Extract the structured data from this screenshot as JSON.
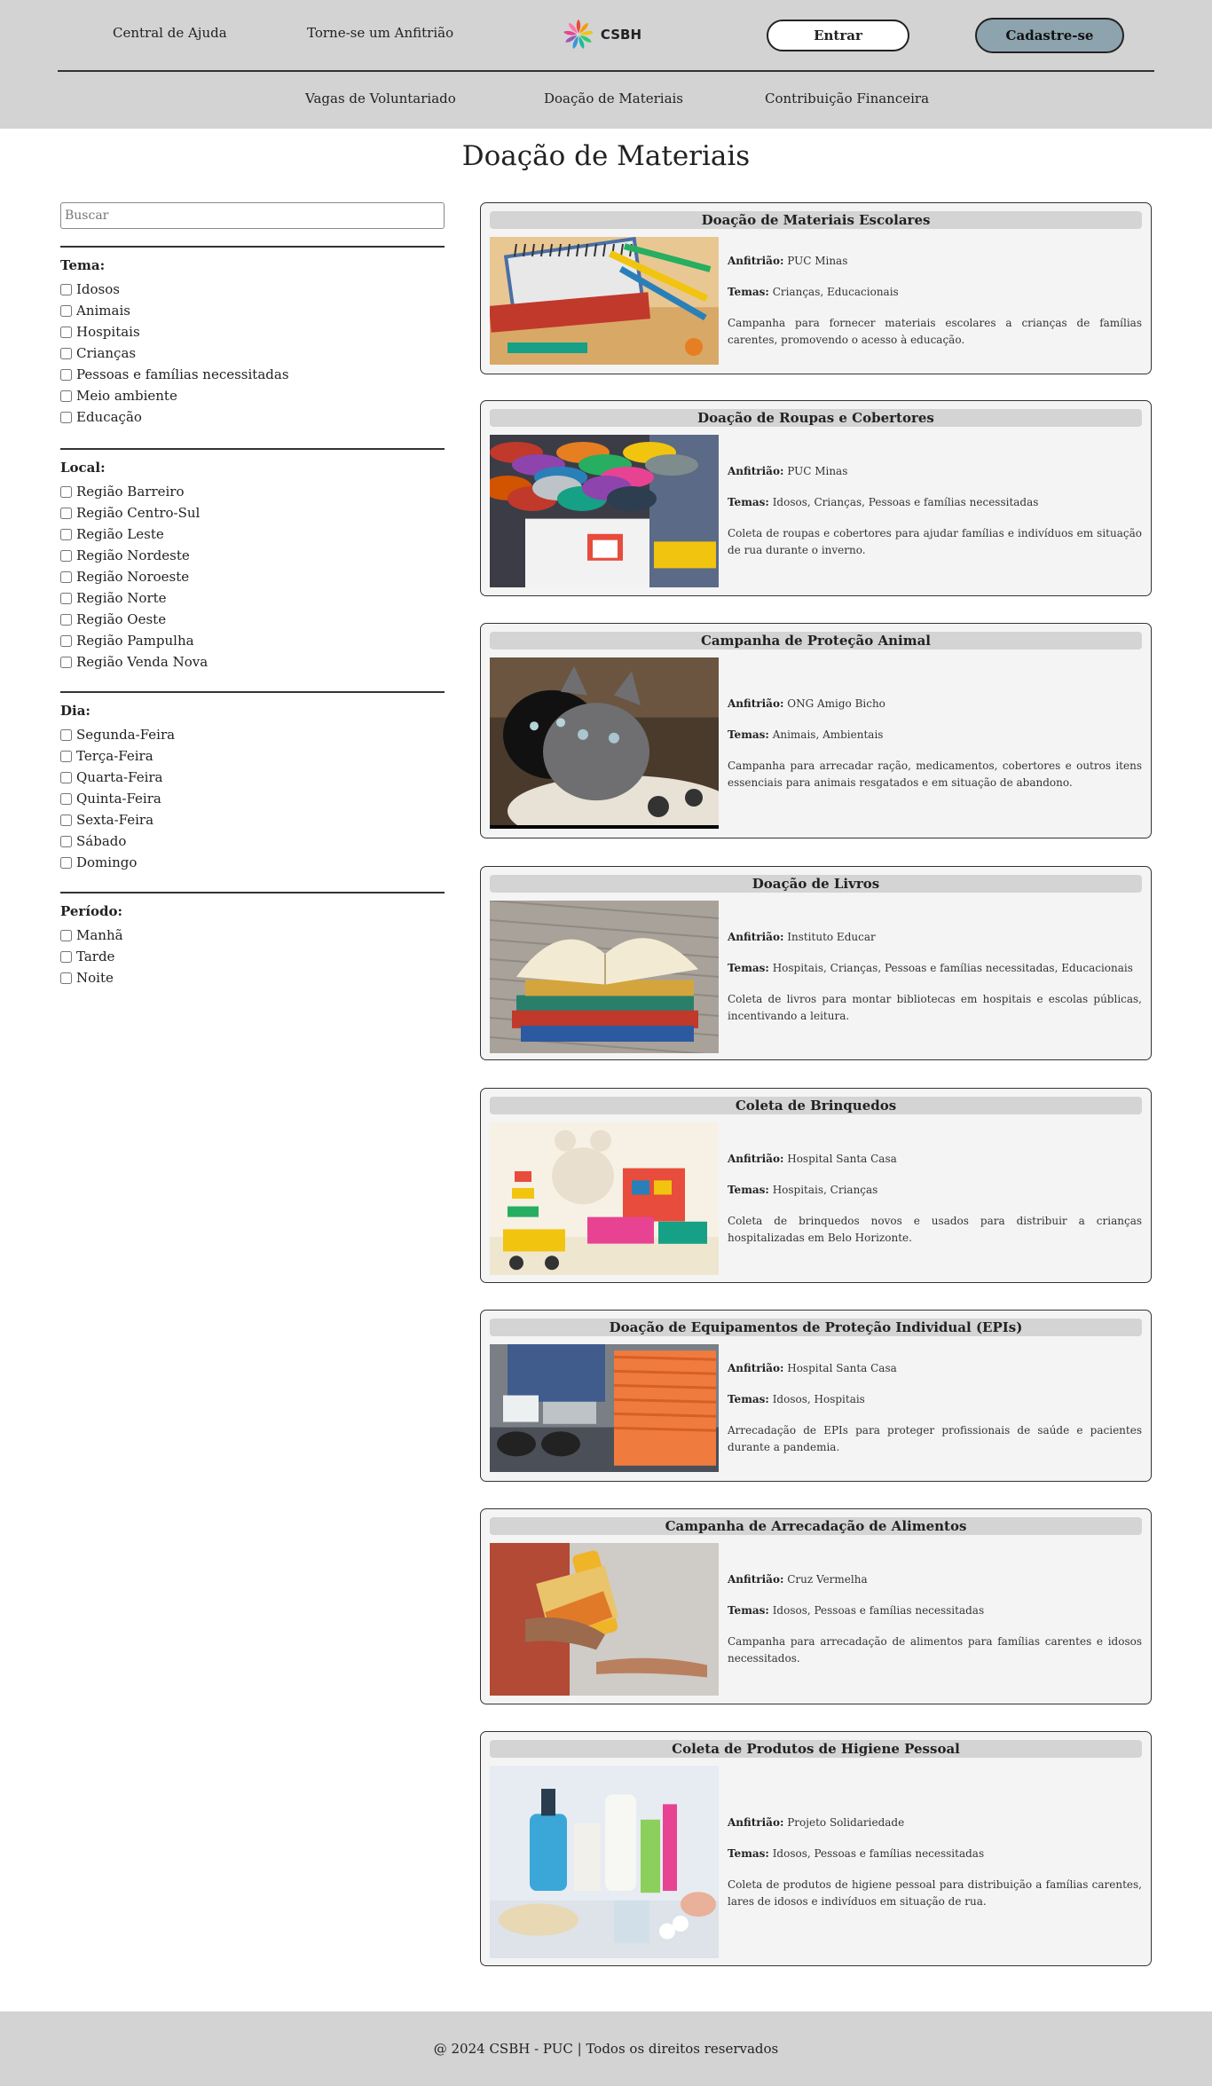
{
  "header": {
    "help_label": "Central de Ajuda",
    "host_label": "Torne-se um Anfitrião",
    "logo_text": "CSBH",
    "login_label": "Entrar",
    "signup_label": "Cadastre-se",
    "nav": [
      "Vagas de Voluntariado",
      "Doação de Materiais",
      "Contribuição Financeira"
    ]
  },
  "page_title": "Doação de Materiais",
  "search": {
    "placeholder": "Buscar"
  },
  "filters": [
    {
      "title": "Tema:",
      "options": [
        "Idosos",
        "Animais",
        "Hospitais",
        "Crianças",
        "Pessoas e famílias necessitadas",
        "Meio ambiente",
        "Educação"
      ]
    },
    {
      "title": "Local:",
      "options": [
        "Região Barreiro",
        "Região Centro-Sul",
        "Região Leste",
        "Região Nordeste",
        "Região Noroeste",
        "Região Norte",
        "Região Oeste",
        "Região Pampulha",
        "Região Venda Nova"
      ]
    },
    {
      "title": "Dia:",
      "options": [
        "Segunda-Feira",
        "Terça-Feira",
        "Quarta-Feira",
        "Quinta-Feira",
        "Sexta-Feira",
        "Sábado",
        "Domingo"
      ]
    },
    {
      "title": "Período:",
      "options": [
        "Manhã",
        "Tarde",
        "Noite"
      ]
    }
  ],
  "card_labels": {
    "host": "Anfitrião:",
    "themes": "Temas:"
  },
  "cards": [
    {
      "title": "Doação de Materiais Escolares",
      "host": "PUC Minas",
      "themes": "Crianças, Educacionais",
      "description": "Campanha para fornecer materiais escolares a crianças de famílias carentes, promovendo o acesso à educação.",
      "image": "school-supplies-photo"
    },
    {
      "title": "Doação de Roupas e Cobertores",
      "host": "PUC Minas",
      "themes": "Idosos, Crianças, Pessoas e famílias necessitadas",
      "description": "Coleta de roupas e cobertores para ajudar famílias e indivíduos em situação de rua durante o inverno.",
      "image": "clothes-donation-photo"
    },
    {
      "title": "Campanha de Proteção Animal",
      "host": "ONG Amigo Bicho",
      "themes": "Animais, Ambientais",
      "description": "Campanha para arrecadar ração, medicamentos, cobertores e outros itens essenciais para animais resgatados e em situação de abandono.",
      "image": "kittens-photo"
    },
    {
      "title": "Doação de Livros",
      "host": "Instituto Educar",
      "themes": "Hospitais, Crianças, Pessoas e famílias necessitadas, Educacionais",
      "description": "Coleta de livros para montar bibliotecas em hospitais e escolas públicas, incentivando a leitura.",
      "image": "books-photo"
    },
    {
      "title": "Coleta de Brinquedos",
      "host": "Hospital Santa Casa",
      "themes": "Hospitais, Crianças",
      "description": "Coleta de brinquedos novos e usados para distribuir a crianças hospitalizadas em Belo Horizonte.",
      "image": "toys-photo"
    },
    {
      "title": "Doação de Equipamentos de Proteção Individual (EPIs)",
      "host": "Hospital Santa Casa",
      "themes": "Idosos, Hospitais",
      "description": "Arrecadação de EPIs para proteger profissionais de saúde e pacientes durante a pandemia.",
      "image": "ppe-photo"
    },
    {
      "title": "Campanha de Arrecadação de Alimentos",
      "host": "Cruz Vermelha",
      "themes": "Idosos, Pessoas e famílias necessitadas",
      "description": "Campanha para arrecadação de alimentos para famílias carentes e idosos necessitados.",
      "image": "food-donation-photo"
    },
    {
      "title": "Coleta de Produtos de Higiene Pessoal",
      "host": "Projeto Solidariedade",
      "themes": "Idosos, Pessoas e famílias necessitadas",
      "description": "Coleta de produtos de higiene pessoal para distribuição a famílias carentes, lares de idosos e indivíduos em situação de rua.",
      "image": "hygiene-products-photo"
    }
  ],
  "footer": {
    "text": "@ 2024 CSBH - PUC | Todos os direitos reservados"
  }
}
